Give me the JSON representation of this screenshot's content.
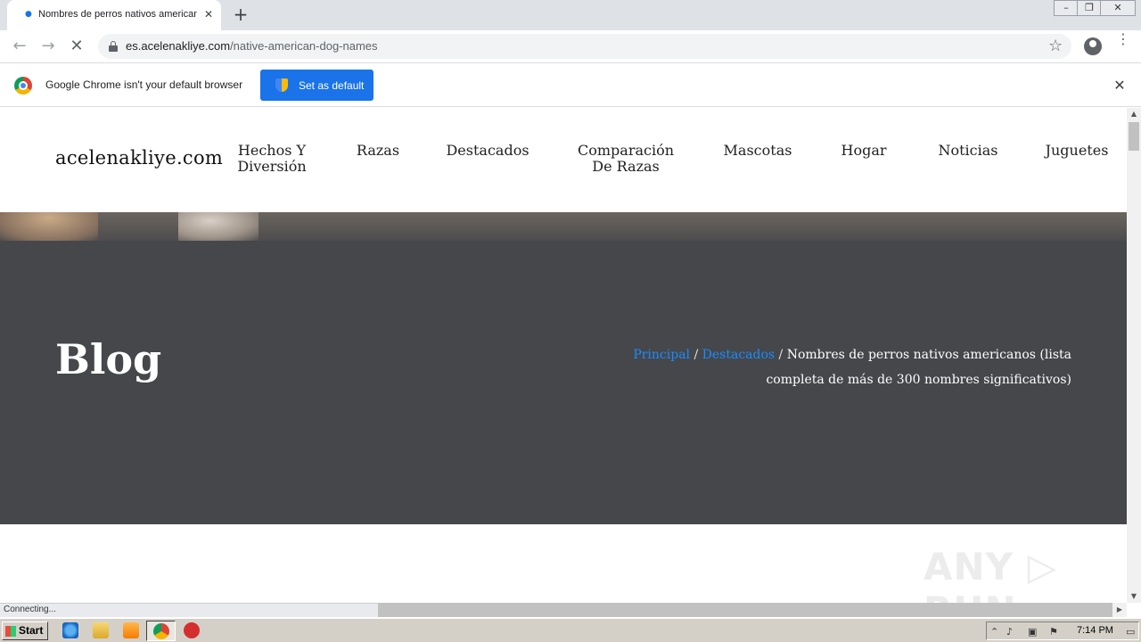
{
  "browser": {
    "tab_title": "Nombres de perros nativos americanos",
    "tab_close": "✕",
    "new_tab": "+",
    "url_domain": "es.acelenakliye.com",
    "url_path": "/native-american-dog-names",
    "back": "←",
    "forward": "→",
    "stop": "✕",
    "star": "☆",
    "menu": "⋮",
    "win_min": "–",
    "win_restore": "❐",
    "win_close": "✕"
  },
  "infobar": {
    "message": "Google Chrome isn't your default browser",
    "button_label": "Set as default",
    "close": "✕"
  },
  "site": {
    "logo": "acelenakliye.com",
    "nav": [
      {
        "label": "Hechos Y\nDiversión"
      },
      {
        "label": "Razas"
      },
      {
        "label": "Destacados"
      },
      {
        "label": "Comparación\nDe Razas"
      },
      {
        "label": "Mascotas"
      },
      {
        "label": "Hogar"
      },
      {
        "label": "Noticias"
      },
      {
        "label": "Juguetes"
      }
    ]
  },
  "hero": {
    "title": "Blog",
    "breadcrumb": {
      "home": "Principal",
      "sep": " / ",
      "category": "Destacados",
      "current": "Nombres de perros nativos americanos (lista completa de más de 300 nombres significativos)"
    }
  },
  "watermark": "ANY ▷ RUN",
  "status": "Connecting...",
  "taskbar": {
    "start_label": "Start",
    "clock": "7:14 PM"
  },
  "colors": {
    "link": "#1a8cff",
    "hero_bg": "#45474b",
    "chrome_blue": "#1a73e8"
  }
}
